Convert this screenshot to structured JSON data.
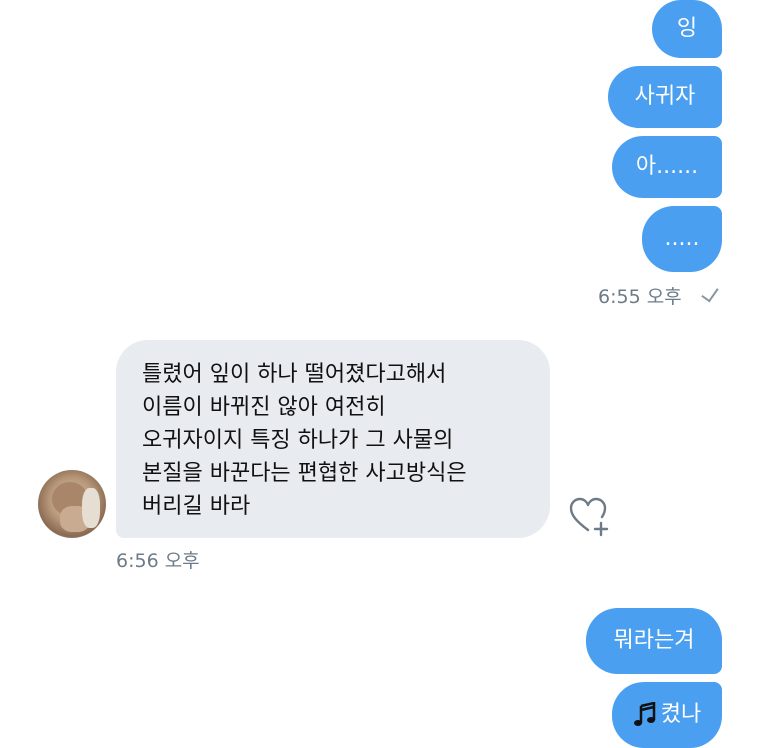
{
  "outgoing_top": [
    {
      "text": "잉"
    },
    {
      "text": "사귀자"
    },
    {
      "text": "아......"
    },
    {
      "text": "....."
    }
  ],
  "outgoing_top_time": "6:55 오후",
  "incoming": {
    "lines": [
      "틀렸어 잎이 하나 떨어졌다고해서",
      "이름이 바뀌진 않아 여전히",
      "오귀자이지 특징 하나가 그 사물의",
      "본질을 바꾼다는 편협한 사고방식은",
      "버리길 바라"
    ],
    "time": "6:56 오후"
  },
  "outgoing_bottom": [
    {
      "text": "뭐라는겨"
    },
    {
      "text": "켰나",
      "prefix_icon": "music-note-icon"
    }
  ],
  "colors": {
    "outgoing_bubble": "#4a9ff0",
    "incoming_bubble": "#e8ecf0",
    "timestamp": "#6d7b88"
  }
}
